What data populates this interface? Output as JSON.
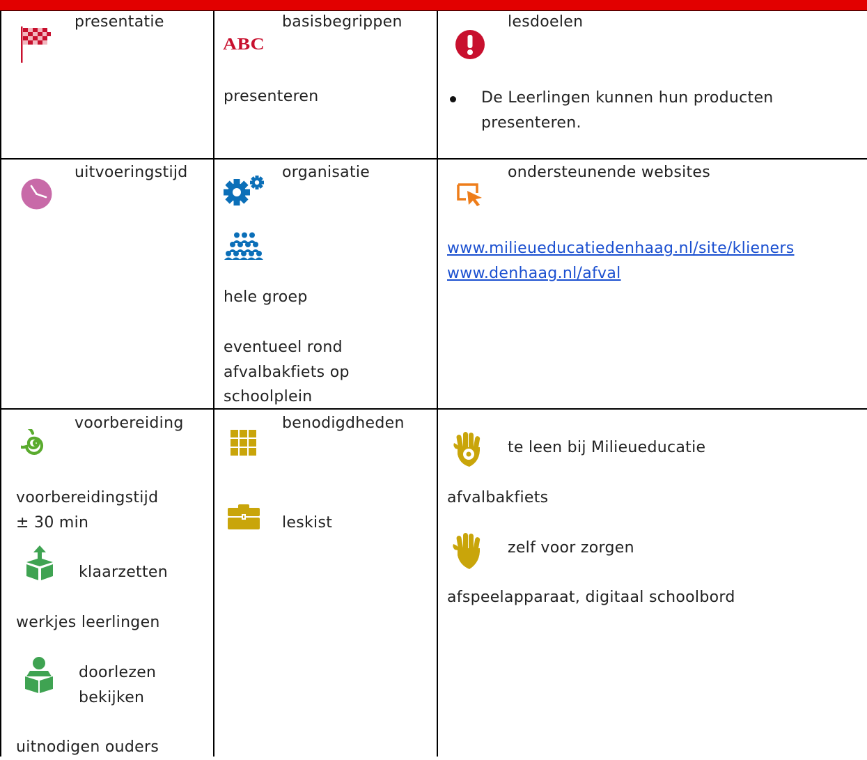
{
  "cells": {
    "presentatie": {
      "title": "presentatie"
    },
    "basisbegrippen": {
      "title": "basisbegrippen",
      "abc": "ABC",
      "term": "presenteren"
    },
    "lesdoelen": {
      "title": "lesdoelen",
      "goal_line1": "De Leerlingen kunnen hun producten",
      "goal_line2": "presenteren."
    },
    "uitvoeringstijd": {
      "title": "uitvoeringstijd"
    },
    "organisatie": {
      "title": "organisatie",
      "group": "hele groep",
      "location_line1": "eventueel rond",
      "location_line2": "afvalbakfiets op",
      "location_line3": "schoolplein"
    },
    "websites": {
      "title": "ondersteunende websites",
      "link1": "www.milieueducatiedenhaag.nl/site/klieners",
      "link2": "www.denhaag.nl/afval"
    },
    "voorbereiding": {
      "title": "voorbereiding",
      "time_label": "voorbereidingstijd",
      "time_value": "± 30 min",
      "klaarzetten": "klaarzetten",
      "klaarzetten_item": "werkjes leerlingen",
      "doorlezen_line1": "doorlezen",
      "doorlezen_line2": "bekijken",
      "extra": "uitnodigen ouders"
    },
    "benodigdheden": {
      "title": "benodigdheden",
      "leskist": "leskist"
    },
    "lenen": {
      "te_leen": "te leen bij Milieueducatie",
      "te_leen_item": "afvalbakfiets",
      "zelf": "zelf voor zorgen",
      "zelf_item": "afspeelapparaat, digitaal schoolbord"
    }
  },
  "colors": {
    "header_red": "#e20000",
    "flag_red": "#c8102e",
    "clock_pink": "#c86aa8",
    "gear_blue": "#0b6fb8",
    "cursor_orange": "#ee7d1a",
    "spiral_green": "#5aab2e",
    "mustard": "#c9a50a",
    "link_blue": "#1a4fd0"
  },
  "icons": [
    "checkered-flag-icon",
    "abc-icon",
    "exclamation-icon",
    "clock-icon",
    "gears-icon",
    "group-icon",
    "cursor-icon",
    "spiral-icon",
    "grid-icon",
    "box-up-icon",
    "reader-icon",
    "suitcase-icon",
    "hand-flower-icon",
    "hand-icon"
  ]
}
